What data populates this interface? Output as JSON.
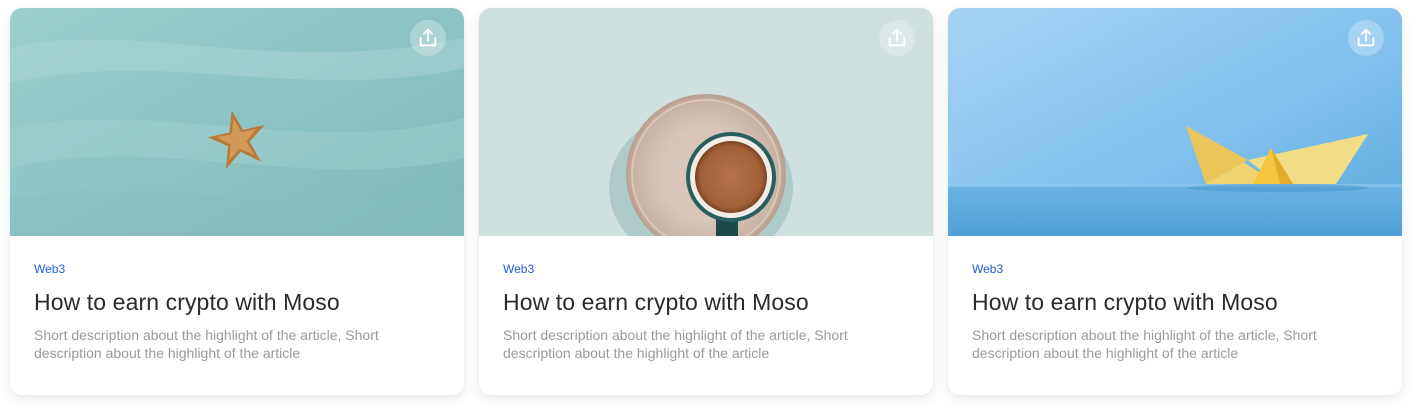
{
  "cards": [
    {
      "image": "starfish on sea-glass sand",
      "share_icon": "share-upload-icon",
      "tag": "Web3",
      "title": "How to earn crypto with Moso",
      "description": "Short description about the highlight of the article, Short description about the highlight of the article"
    },
    {
      "image": "cup of coffee on saucer, top view",
      "share_icon": "share-upload-icon",
      "tag": "Web3",
      "title": "How to earn crypto with Moso",
      "description": "Short description about the highlight of the article, Short description about the highlight of the article"
    },
    {
      "image": "yellow paper boat on blue background",
      "share_icon": "share-upload-icon",
      "tag": "Web3",
      "title": "How to earn crypto with Moso",
      "description": "Short description about the highlight of the article, Short description about the highlight of the article"
    }
  ],
  "colors": {
    "tag": "#1f5fd6",
    "title": "#2b2b2b",
    "description": "#9a9a9a"
  }
}
